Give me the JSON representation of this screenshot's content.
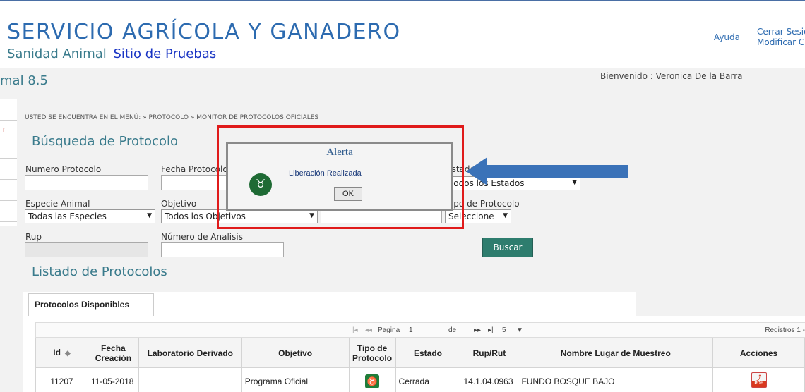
{
  "header": {
    "org_title": "SERVICIO AGRÍCOLA Y GANADERO",
    "subtitle_a": "Sanidad Animal",
    "subtitle_b": "Sitio de Pruebas",
    "help": "Ayuda",
    "logout": "Cerrar Sesión",
    "modify": "Modificar Clave"
  },
  "version": "mal 8.5",
  "welcome": "Bienvenido : Veronica De la Barra",
  "left_link": "r",
  "breadcrumb": "USTED SE ENCUENTRA EN EL MENÚ: » PROTOCOLO » MONITOR DE PROTOCOLOS OFICIALES",
  "search": {
    "title": "Búsqueda de Protocolo",
    "numero_label": "Numero Protocolo",
    "fecha_label": "Fecha Protocolo",
    "estado_label": "Estado Protocolo",
    "estado_value": "Todos los Estados",
    "especie_label": "Especie Animal",
    "especie_value": "Todas las Especies",
    "objetivo_label": "Objetivo",
    "objetivo_value": "Todos los Objetivos",
    "tipo_label": "Tipo de Protocolo",
    "tipo_value": "Seleccione",
    "rup_label": "Rup",
    "analisis_label": "Número de Analisis",
    "buscar": "Buscar"
  },
  "list": {
    "title": "Listado de Protocolos",
    "tab": "Protocolos Disponibles",
    "pager": {
      "page_label": "Pagina",
      "page": "1",
      "of_label": "de",
      "total_pages": "5",
      "records": "Registros 1 -"
    },
    "columns": [
      "Id",
      "Fecha Creación",
      "Laboratorio Derivado",
      "Objetivo",
      "Tipo de Protocolo",
      "Estado",
      "Rup/Rut",
      "Nombre Lugar de Muestreo",
      "Acciones"
    ],
    "rows": [
      {
        "id": "11207",
        "fecha": "11-05-2018",
        "laboratorio": "",
        "objetivo": "Programa Oficial",
        "estado": "Cerrada",
        "rup": "14.1.04.0963",
        "lugar": "FUNDO BOSQUE BAJO"
      }
    ]
  },
  "dialog": {
    "title": "Alerta",
    "message": "Liberación Realizada",
    "ok": "OK"
  },
  "colors": {
    "title_blue": "#2d6bb0",
    "teal": "#3a7b8c",
    "highlight_red": "#e01b1b",
    "arrow_blue": "#3a72b8",
    "button_green": "#2e7d6e"
  },
  "icons": {
    "dialog": "sag-cow-icon",
    "tipo": "cow-icon",
    "accion": "pdf-icon"
  }
}
